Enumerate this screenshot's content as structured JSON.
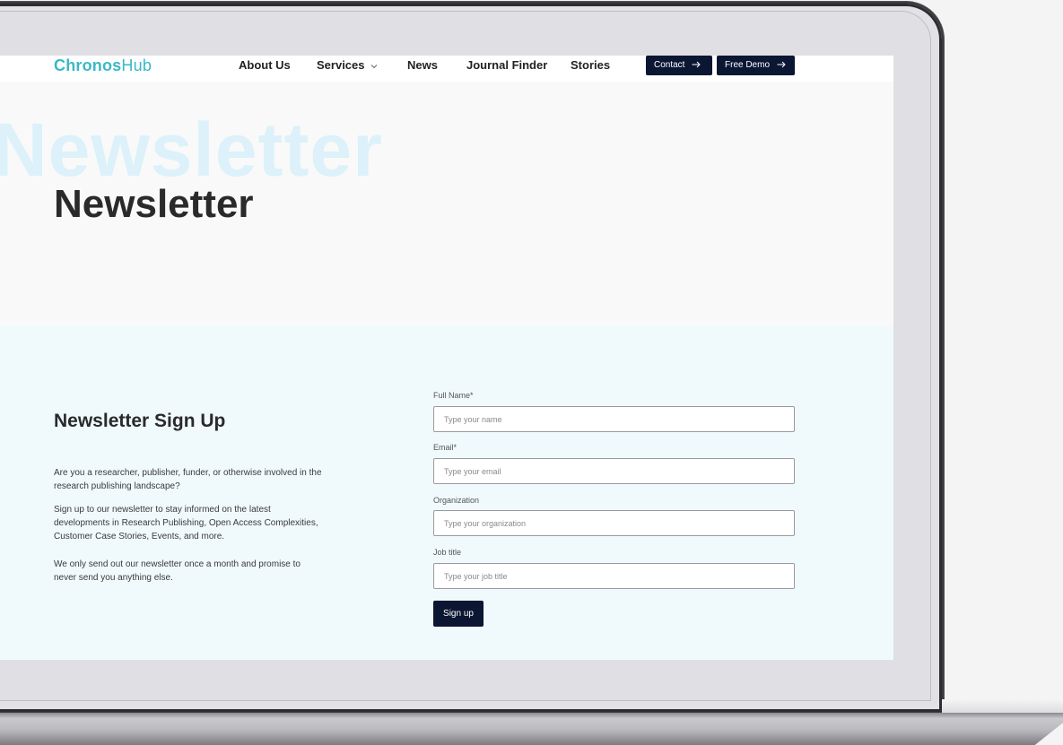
{
  "nav": {
    "logo_part1": "Chronos",
    "logo_part2": "Hub",
    "links": [
      "About Us",
      "Services",
      "News",
      "Journal Finder",
      "Stories"
    ],
    "contact_label": "Contact",
    "demo_label": "Free Demo"
  },
  "hero": {
    "bg_text": "Newsletter",
    "title": "Newsletter"
  },
  "signup": {
    "heading": "Newsletter Sign Up",
    "paragraphs": [
      "Are you a researcher, publisher, funder, or otherwise involved in the research publishing landscape?",
      "Sign up to our newsletter to stay informed on the latest developments in Research Publishing, Open Access Complexities, Customer Case Stories, Events, and more.",
      "We only send out our newsletter once a month and promise to never send you anything else."
    ],
    "fields": {
      "name_label": "Full Name*",
      "name_placeholder": "Type your name",
      "email_label": "Email*",
      "email_placeholder": "Type your email",
      "org_label": "Organization",
      "org_placeholder": "Type your organization",
      "job_label": "Job title",
      "job_placeholder": "Type your job title"
    },
    "submit_label": "Sign up"
  },
  "colors": {
    "brand": "#3ab8c8",
    "button_bg": "#0b1633",
    "signup_bg": "#f0fafd",
    "hero_bg_text": "#dcf1f9"
  },
  "icons": [
    "chevron-down-icon",
    "arrow-right-icon"
  ]
}
